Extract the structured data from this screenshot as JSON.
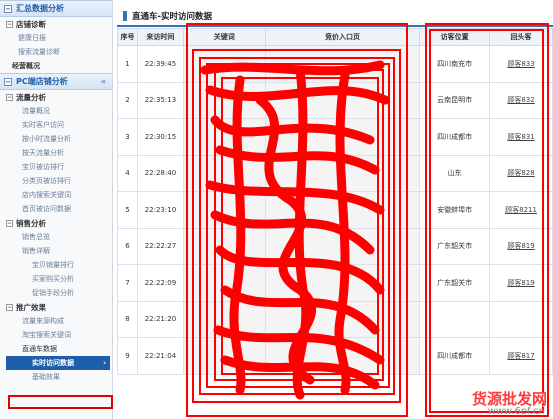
{
  "sidebar": {
    "sec1": {
      "title": "汇总数据分析",
      "toggle": "−"
    },
    "g1": {
      "title": "店铺诊断",
      "items": [
        "健康日报",
        "搜索流量诊断"
      ]
    },
    "g1_bold": "经营概况",
    "sec2": {
      "title": "PC端店铺分析",
      "toggle": "−"
    },
    "g2": {
      "title": "流量分析",
      "items": [
        "流量概况",
        "实时客户访问",
        "按小时流量分析",
        "按天流量分析",
        "宝贝被访排行",
        "分类页被访排行",
        "店内搜索关键词",
        "首页被访问数据"
      ]
    },
    "g3": {
      "title": "销售分析",
      "items": [
        "销售总览",
        "销售详解",
        "宝贝销量排行",
        "买家购买分析",
        "促销手段分析"
      ]
    },
    "g4": {
      "title": "推广效果",
      "items": [
        "流量来源构成",
        "淘宝搜索关键词",
        "直通车数据"
      ]
    },
    "active": "实时访问数据",
    "last": "基础效果"
  },
  "main": {
    "title": "直通车-实时访问数据",
    "headers": [
      "序号",
      "来访时间",
      "关键词",
      "竞价入口页",
      "访客位置",
      "回头客"
    ],
    "rows": [
      {
        "no": "1",
        "time": "22:39:45",
        "loc": "四川南充市",
        "cust": "顾客833"
      },
      {
        "no": "2",
        "time": "22:35:13",
        "loc": "云南昆明市",
        "cust": "顾客832"
      },
      {
        "no": "3",
        "time": "22:30:15",
        "loc": "四川成都市",
        "cust": "顾客831"
      },
      {
        "no": "4",
        "time": "22:28:40",
        "loc": "山东",
        "cust": "顾客828"
      },
      {
        "no": "5",
        "time": "22:23:10",
        "loc": "安徽蚌埠市",
        "cust": "顾客8211"
      },
      {
        "no": "6",
        "time": "22:22:27",
        "loc": "广东韶关市",
        "cust": "顾客819"
      },
      {
        "no": "7",
        "time": "22:22:09",
        "loc": "广东韶关市",
        "cust": "顾客819"
      },
      {
        "no": "8",
        "time": "22:21:20",
        "loc": "",
        "cust": ""
      },
      {
        "no": "9",
        "time": "22:21:04",
        "loc": "四川成都市",
        "cust": "顾客817"
      }
    ]
  },
  "watermark": {
    "text": "货源批发网",
    "url": "www.6pf.cn"
  },
  "colors": {
    "accent": "#1f5ea8",
    "scribble": "#ff0000"
  }
}
